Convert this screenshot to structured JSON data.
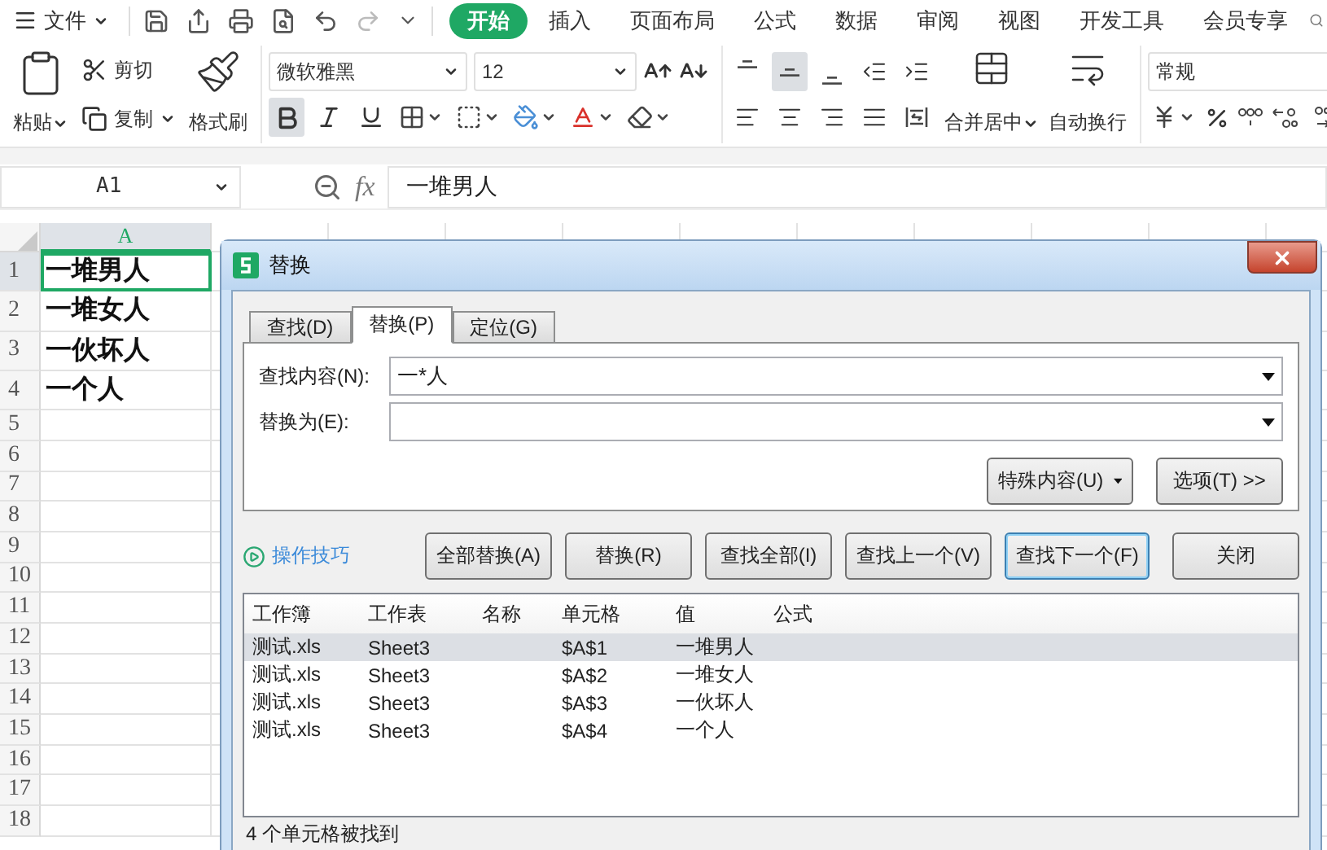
{
  "menu": {
    "file": "文件",
    "tabs": [
      {
        "label": "开始",
        "selected": true
      },
      {
        "label": "插入",
        "selected": false
      },
      {
        "label": "页面布局",
        "selected": false
      },
      {
        "label": "公式",
        "selected": false
      },
      {
        "label": "数据",
        "selected": false
      },
      {
        "label": "审阅",
        "selected": false
      },
      {
        "label": "视图",
        "selected": false
      },
      {
        "label": "开发工具",
        "selected": false
      },
      {
        "label": "会员专享",
        "selected": false
      }
    ]
  },
  "ribbon": {
    "paste": "粘贴",
    "cut": "剪切",
    "copy": "复制",
    "format_painter": "格式刷",
    "font": "微软雅黑",
    "size": "12",
    "font_toggles": [
      {
        "kind": "bold",
        "selected": true
      },
      {
        "kind": "italic",
        "selected": false
      },
      {
        "kind": "underline",
        "selected": false
      }
    ],
    "align_buttons": [
      {
        "kind": "top",
        "selected": false
      },
      {
        "kind": "middle",
        "selected": true
      },
      {
        "kind": "bottom",
        "selected": false
      },
      {
        "kind": "indent_less",
        "selected": false
      },
      {
        "kind": "indent_more",
        "selected": false
      },
      {
        "kind": "left",
        "selected": false
      },
      {
        "kind": "center",
        "selected": false
      },
      {
        "kind": "right",
        "selected": false
      },
      {
        "kind": "justify",
        "selected": false
      },
      {
        "kind": "distributed",
        "selected": false
      }
    ],
    "merge": "合并居中",
    "wrap": "自动换行",
    "number_format": "常规"
  },
  "formula_bar": {
    "cell": "A1",
    "fx": "fx",
    "formula": "一堆男人"
  },
  "sheet": {
    "column": "A",
    "rows": [
      {
        "number": "1",
        "value": "一堆男人",
        "selected": true
      },
      {
        "number": "2",
        "value": "一堆女人",
        "selected": false
      },
      {
        "number": "3",
        "value": "一伙坏人",
        "selected": false
      },
      {
        "number": "4",
        "value": "一个人",
        "selected": false
      },
      {
        "number": "5",
        "selected": false
      },
      {
        "number": "6",
        "selected": false
      },
      {
        "number": "7",
        "selected": false
      },
      {
        "number": "8",
        "selected": false
      },
      {
        "number": "9",
        "selected": false
      },
      {
        "number": "10",
        "selected": false
      },
      {
        "number": "11",
        "selected": false
      },
      {
        "number": "12",
        "selected": false
      },
      {
        "number": "13",
        "selected": false
      },
      {
        "number": "14",
        "selected": false
      },
      {
        "number": "15",
        "selected": false
      },
      {
        "number": "16",
        "selected": false
      },
      {
        "number": "17",
        "selected": false
      },
      {
        "number": "18",
        "selected": false
      }
    ]
  },
  "dialog": {
    "title": "替换",
    "tabs": [
      {
        "label": "查找(D)",
        "selected": false
      },
      {
        "label": "替换(P)",
        "selected": true
      },
      {
        "label": "定位(G)",
        "selected": false
      }
    ],
    "fields": [
      {
        "label": "查找内容(N):",
        "value": "一*人"
      },
      {
        "label": "替换为(E):"
      }
    ],
    "special_button": "特殊内容(U)",
    "options_button": "选项(T) >>",
    "tips_link": "操作技巧",
    "buttons": [
      {
        "label": "全部替换(A)",
        "focused": false
      },
      {
        "label": "替换(R)",
        "focused": false
      },
      {
        "label": "查找全部(I)",
        "focused": false
      },
      {
        "label": "查找上一个(V)",
        "focused": false
      },
      {
        "label": "查找下一个(F)",
        "focused": true
      },
      {
        "label": "关闭",
        "focused": false
      }
    ],
    "results": {
      "columns": [
        "工作簿",
        "工作表",
        "名称",
        "单元格",
        "值",
        "公式"
      ],
      "rows": [
        {
          "cells": [
            "测试.xls",
            "Sheet3",
            "",
            "$A$1",
            "一堆男人",
            ""
          ],
          "selected": true
        },
        {
          "cells": [
            "测试.xls",
            "Sheet3",
            "",
            "$A$2",
            "一堆女人",
            ""
          ],
          "selected": false
        },
        {
          "cells": [
            "测试.xls",
            "Sheet3",
            "",
            "$A$3",
            "一伙坏人",
            ""
          ],
          "selected": false
        },
        {
          "cells": [
            "测试.xls",
            "Sheet3",
            "",
            "$A$4",
            "一个人",
            ""
          ],
          "selected": false
        }
      ]
    },
    "status": "4 个单元格被找到"
  }
}
